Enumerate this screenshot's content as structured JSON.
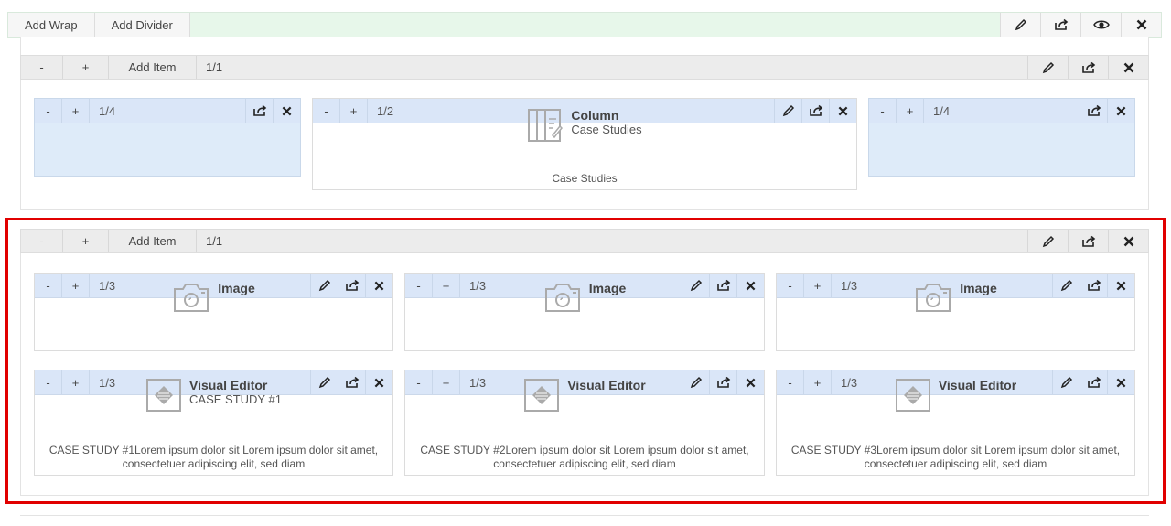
{
  "toolbar": {
    "add_wrap": "Add Wrap",
    "add_divider": "Add Divider",
    "icons": [
      "pencil-icon",
      "export-icon",
      "eye-icon",
      "close-icon"
    ]
  },
  "row1": {
    "minus": "-",
    "plus": "+",
    "add_item": "Add Item",
    "fraction": "1/1",
    "columns": [
      {
        "minus": "-",
        "plus": "+",
        "fraction": "1/4"
      },
      {
        "minus": "-",
        "plus": "+",
        "fraction": "1/2",
        "module": {
          "title": "Column",
          "subtitle": "Case Studies",
          "caption": "Case Studies",
          "icon": "column-icon"
        }
      },
      {
        "minus": "-",
        "plus": "+",
        "fraction": "1/4"
      }
    ]
  },
  "row2": {
    "minus": "-",
    "plus": "+",
    "add_item": "Add Item",
    "fraction": "1/1",
    "columns": [
      {
        "minus": "-",
        "plus": "+",
        "fraction": "1/3",
        "module": {
          "title": "Image",
          "icon": "camera-icon"
        }
      },
      {
        "minus": "-",
        "plus": "+",
        "fraction": "1/3",
        "module": {
          "title": "Image",
          "icon": "camera-icon"
        }
      },
      {
        "minus": "-",
        "plus": "+",
        "fraction": "1/3",
        "module": {
          "title": "Image",
          "icon": "camera-icon"
        }
      },
      {
        "minus": "-",
        "plus": "+",
        "fraction": "1/3",
        "module": {
          "title": "Visual Editor",
          "subtitle": "CASE STUDY #1",
          "icon": "visual-editor-icon",
          "desc_line1": "CASE STUDY #1Lorem ipsum dolor sit Lorem ipsum dolor sit amet,",
          "desc_line2": "consectetuer adipiscing elit, sed diam"
        }
      },
      {
        "minus": "-",
        "plus": "+",
        "fraction": "1/3",
        "module": {
          "title": "Visual Editor",
          "icon": "visual-editor-icon",
          "desc_line1": "CASE STUDY #2Lorem ipsum dolor sit Lorem ipsum dolor sit amet,",
          "desc_line2": "consectetuer adipiscing elit, sed diam"
        }
      },
      {
        "minus": "-",
        "plus": "+",
        "fraction": "1/3",
        "module": {
          "title": "Visual Editor",
          "icon": "visual-editor-icon",
          "desc_line1": "CASE STUDY #3Lorem ipsum dolor sit Lorem ipsum dolor sit amet,",
          "desc_line2": "consectetuer adipiscing elit, sed diam"
        }
      }
    ]
  },
  "colors": {
    "highlight": "#e10000",
    "toolbar_bg": "#e7f7ea",
    "column_bar": "#dae6f8"
  }
}
